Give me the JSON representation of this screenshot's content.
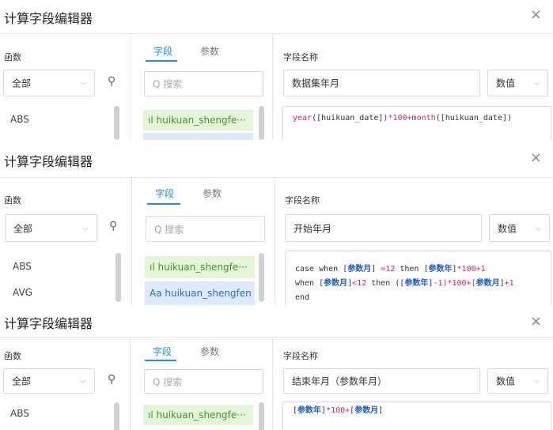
{
  "panels": [
    {
      "title": "计算字段编辑器",
      "close": "×",
      "functions_label": "函数",
      "tabs": [
        "字段",
        "参数"
      ],
      "field_name_label": "字段名称",
      "category_select": "全部",
      "search_placeholder": "搜索",
      "field_name_value": "数据集年月",
      "type_select": "数值",
      "functions": [
        "ABS"
      ],
      "fields": [
        {
          "icon": "ıl",
          "name": "huikuan_shengfe···",
          "kind": "number"
        }
      ],
      "formula_tokens": [
        [
          {
            "t": "year",
            "c": "fn"
          },
          {
            "t": "([",
            "c": "kw"
          },
          {
            "t": "huikuan_date",
            "c": "kw"
          },
          {
            "t": "])",
            "c": "kw"
          },
          {
            "t": "*100+",
            "c": "op"
          },
          {
            "t": "month",
            "c": "fn"
          },
          {
            "t": "([",
            "c": "kw"
          },
          {
            "t": "huikuan_date",
            "c": "kw"
          },
          {
            "t": "])",
            "c": "kw"
          }
        ]
      ]
    },
    {
      "title": "计算字段编辑器",
      "close": "×",
      "functions_label": "函数",
      "tabs": [
        "字段",
        "参数"
      ],
      "field_name_label": "字段名称",
      "category_select": "全部",
      "search_placeholder": "搜索",
      "field_name_value": "开始年月",
      "type_select": "数值",
      "functions": [
        "ABS",
        "AVG"
      ],
      "fields": [
        {
          "icon": "ıl",
          "name": "huikuan_shengfe···",
          "kind": "number"
        },
        {
          "icon": "Aa",
          "name": "huikuan_shengfen",
          "kind": "text"
        }
      ],
      "formula_tokens": [
        [
          {
            "t": "case when [",
            "c": "kw"
          },
          {
            "t": "参数月",
            "c": "ref"
          },
          {
            "t": "] ",
            "c": "kw"
          },
          {
            "t": "=12",
            "c": "op"
          },
          {
            "t": " then [",
            "c": "kw"
          },
          {
            "t": "参数年",
            "c": "ref"
          },
          {
            "t": "]",
            "c": "kw"
          },
          {
            "t": "*100+1",
            "c": "op"
          }
        ],
        [
          {
            "t": "when [",
            "c": "kw"
          },
          {
            "t": "参数月",
            "c": "ref"
          },
          {
            "t": "]",
            "c": "kw"
          },
          {
            "t": "<12",
            "c": "op"
          },
          {
            "t": " then ([",
            "c": "kw"
          },
          {
            "t": "参数年",
            "c": "ref"
          },
          {
            "t": "]",
            "c": "kw"
          },
          {
            "t": "-1)*100+[",
            "c": "op"
          },
          {
            "t": "参数月",
            "c": "ref"
          },
          {
            "t": "]",
            "c": "kw"
          },
          {
            "t": "+1",
            "c": "op"
          }
        ],
        [
          {
            "t": "end",
            "c": "kw"
          }
        ]
      ]
    },
    {
      "title": "计算字段编辑器",
      "close": "×",
      "functions_label": "函数",
      "tabs": [
        "字段",
        "参数"
      ],
      "field_name_label": "字段名称",
      "category_select": "全部",
      "search_placeholder": "搜索",
      "field_name_value": "结束年月（参数年月）",
      "type_select": "数值",
      "functions": [
        "ABS"
      ],
      "fields": [
        {
          "icon": "ıl",
          "name": "huikuan_shengfe···",
          "kind": "number"
        }
      ],
      "formula_tokens": [
        [
          {
            "t": "[",
            "c": "kw"
          },
          {
            "t": "参数年",
            "c": "ref"
          },
          {
            "t": "]",
            "c": "kw"
          },
          {
            "t": "*100+",
            "c": "op"
          },
          {
            "t": "[",
            "c": "kw"
          },
          {
            "t": "参数月",
            "c": "ref"
          },
          {
            "t": "]",
            "c": "kw"
          }
        ]
      ]
    }
  ],
  "icons": {
    "search": "search-icon",
    "chevron": "chevron-down-icon",
    "close": "close-icon",
    "number_field": "bar-chart-icon",
    "text_field": "text-type-icon"
  },
  "colors": {
    "accent": "#1a8cff",
    "number_field_bg": "#e4f5d8",
    "text_field_bg": "#dceafb",
    "function_pink": "#d6246e"
  }
}
